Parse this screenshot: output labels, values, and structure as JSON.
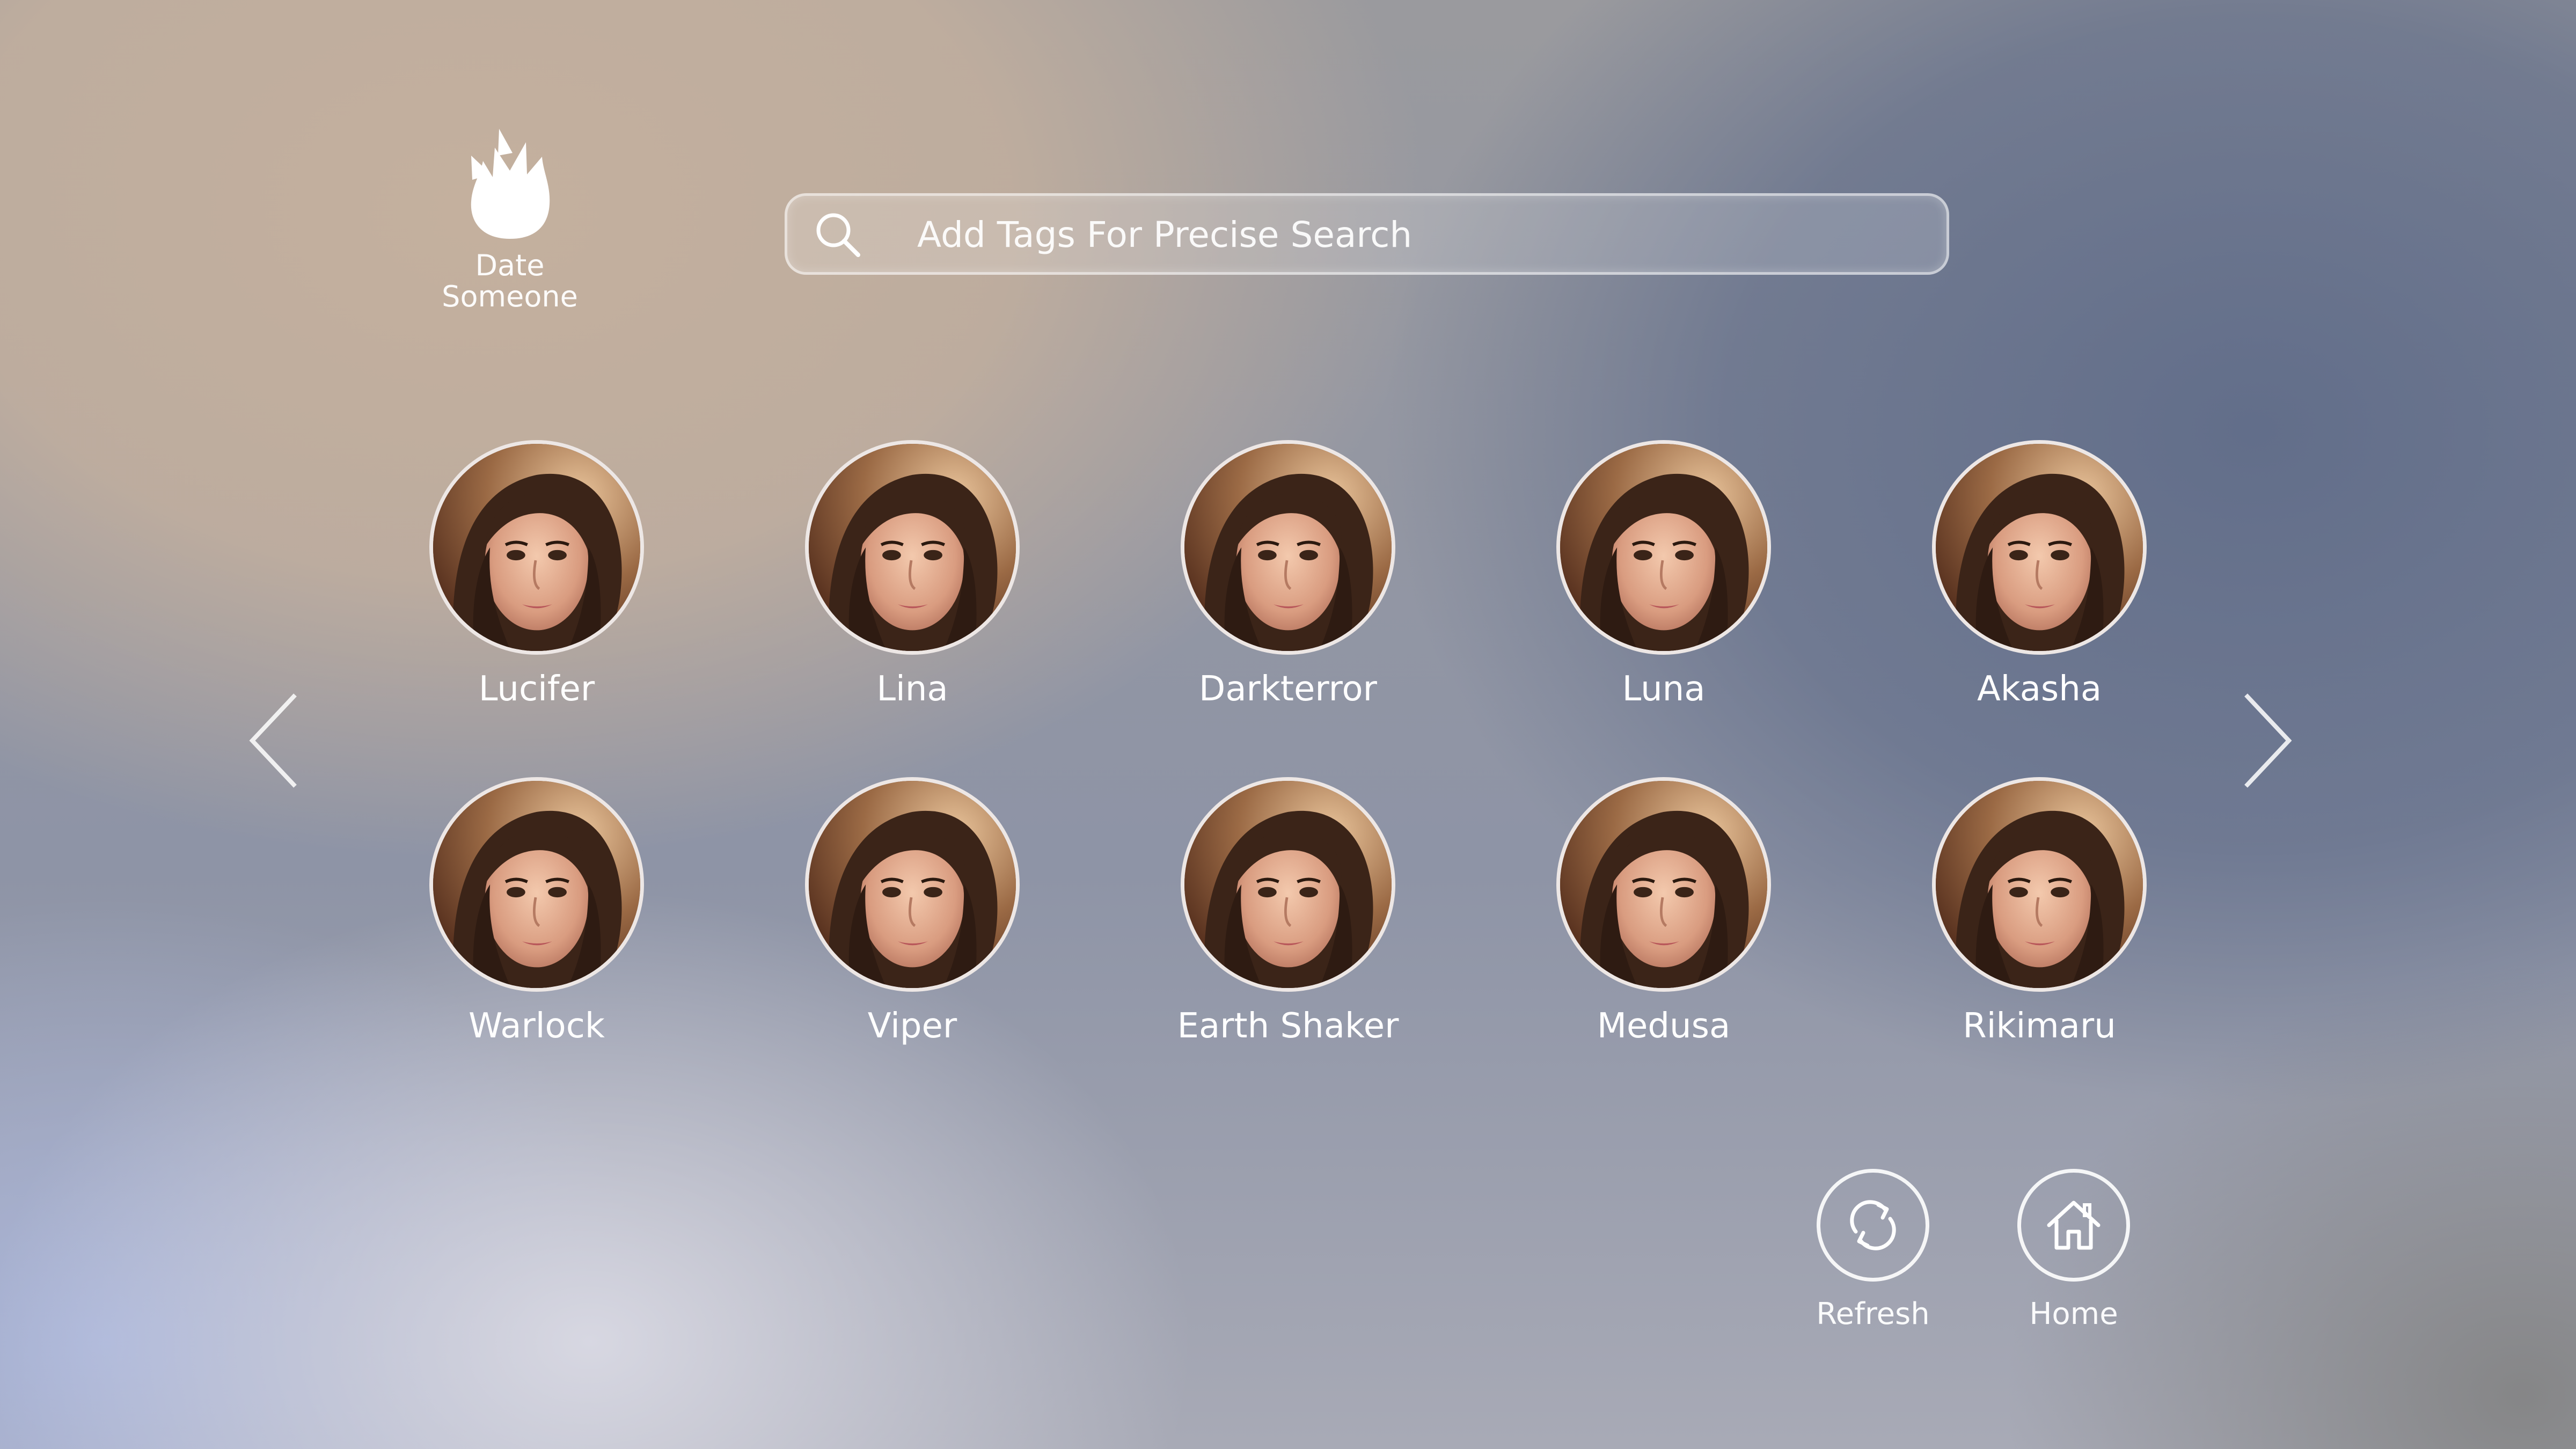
{
  "app": {
    "logo_icon": "rose-icon",
    "name_line1": "Date",
    "name_line2": "Someone"
  },
  "search": {
    "placeholder": "Add Tags For Precise Search",
    "icon": "search-icon"
  },
  "navigation": {
    "prev_icon": "chevron-left-icon",
    "next_icon": "chevron-right-icon"
  },
  "profiles": [
    {
      "name": "Lucifer"
    },
    {
      "name": "Lina"
    },
    {
      "name": "Darkterror"
    },
    {
      "name": "Luna"
    },
    {
      "name": "Akasha"
    },
    {
      "name": "Warlock"
    },
    {
      "name": "Viper"
    },
    {
      "name": "Earth Shaker"
    },
    {
      "name": "Medusa"
    },
    {
      "name": "Rikimaru"
    }
  ],
  "actions": {
    "refresh": {
      "label": "Refresh",
      "icon": "refresh-icon"
    },
    "home": {
      "label": "Home",
      "icon": "home-icon"
    }
  },
  "colors": {
    "text": "#ffffff",
    "avatar_border": "#ffffff"
  }
}
